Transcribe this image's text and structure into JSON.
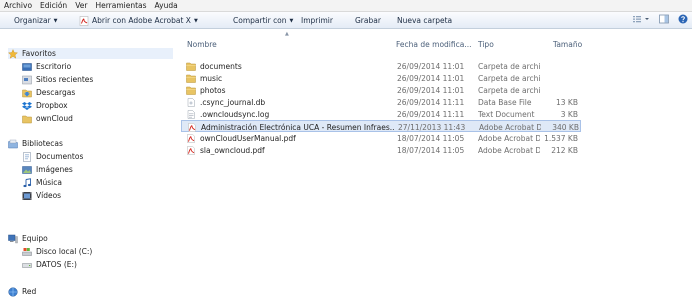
{
  "menu": [
    "Archivo",
    "Edición",
    "Ver",
    "Herramientas",
    "Ayuda"
  ],
  "toolbar": {
    "organize": "Organizar",
    "open_with": "Abrir con Adobe Acrobat X",
    "share": "Compartir con",
    "print": "Imprimir",
    "burn": "Grabar",
    "new_folder": "Nueva carpeta"
  },
  "nav": {
    "favorites": "Favoritos",
    "fav_items": [
      "Escritorio",
      "Sitios recientes",
      "Descargas",
      "Dropbox",
      "ownCloud"
    ],
    "libraries": "Bibliotecas",
    "lib_items": [
      "Documentos",
      "Imágenes",
      "Música",
      "Vídeos"
    ],
    "computer": "Equipo",
    "comp_items": [
      "Disco local (C:)",
      "DATOS (E:)"
    ],
    "network": "Red"
  },
  "columns": {
    "name": "Nombre",
    "date": "Fecha de modifica...",
    "type": "Tipo",
    "size": "Tamaño"
  },
  "files": [
    {
      "name": "documents",
      "date": "26/09/2014 11:01",
      "type": "Carpeta de archivos",
      "size": "",
      "icon": "folder"
    },
    {
      "name": "music",
      "date": "26/09/2014 11:01",
      "type": "Carpeta de archivos",
      "size": "",
      "icon": "folder"
    },
    {
      "name": "photos",
      "date": "26/09/2014 11:01",
      "type": "Carpeta de archivos",
      "size": "",
      "icon": "folder"
    },
    {
      "name": ".csync_journal.db",
      "date": "26/09/2014 11:11",
      "type": "Data Base File",
      "size": "13 KB",
      "icon": "file"
    },
    {
      "name": ".owncloudsync.log",
      "date": "26/09/2014 11:11",
      "type": "Text Document",
      "size": "3 KB",
      "icon": "text"
    },
    {
      "name": "Administración Electrónica UCA - Resumen Infraes...",
      "date": "27/11/2013 11:43",
      "type": "Adobe Acrobat D...",
      "size": "340 KB",
      "icon": "pdf"
    },
    {
      "name": "ownCloudUserManual.pdf",
      "date": "18/07/2014 11:05",
      "type": "Adobe Acrobat D...",
      "size": "1.537 KB",
      "icon": "pdf"
    },
    {
      "name": "sla_owncloud.pdf",
      "date": "18/07/2014 11:05",
      "type": "Adobe Acrobat D...",
      "size": "212 KB",
      "icon": "pdf"
    }
  ],
  "selected_file_index": 5
}
